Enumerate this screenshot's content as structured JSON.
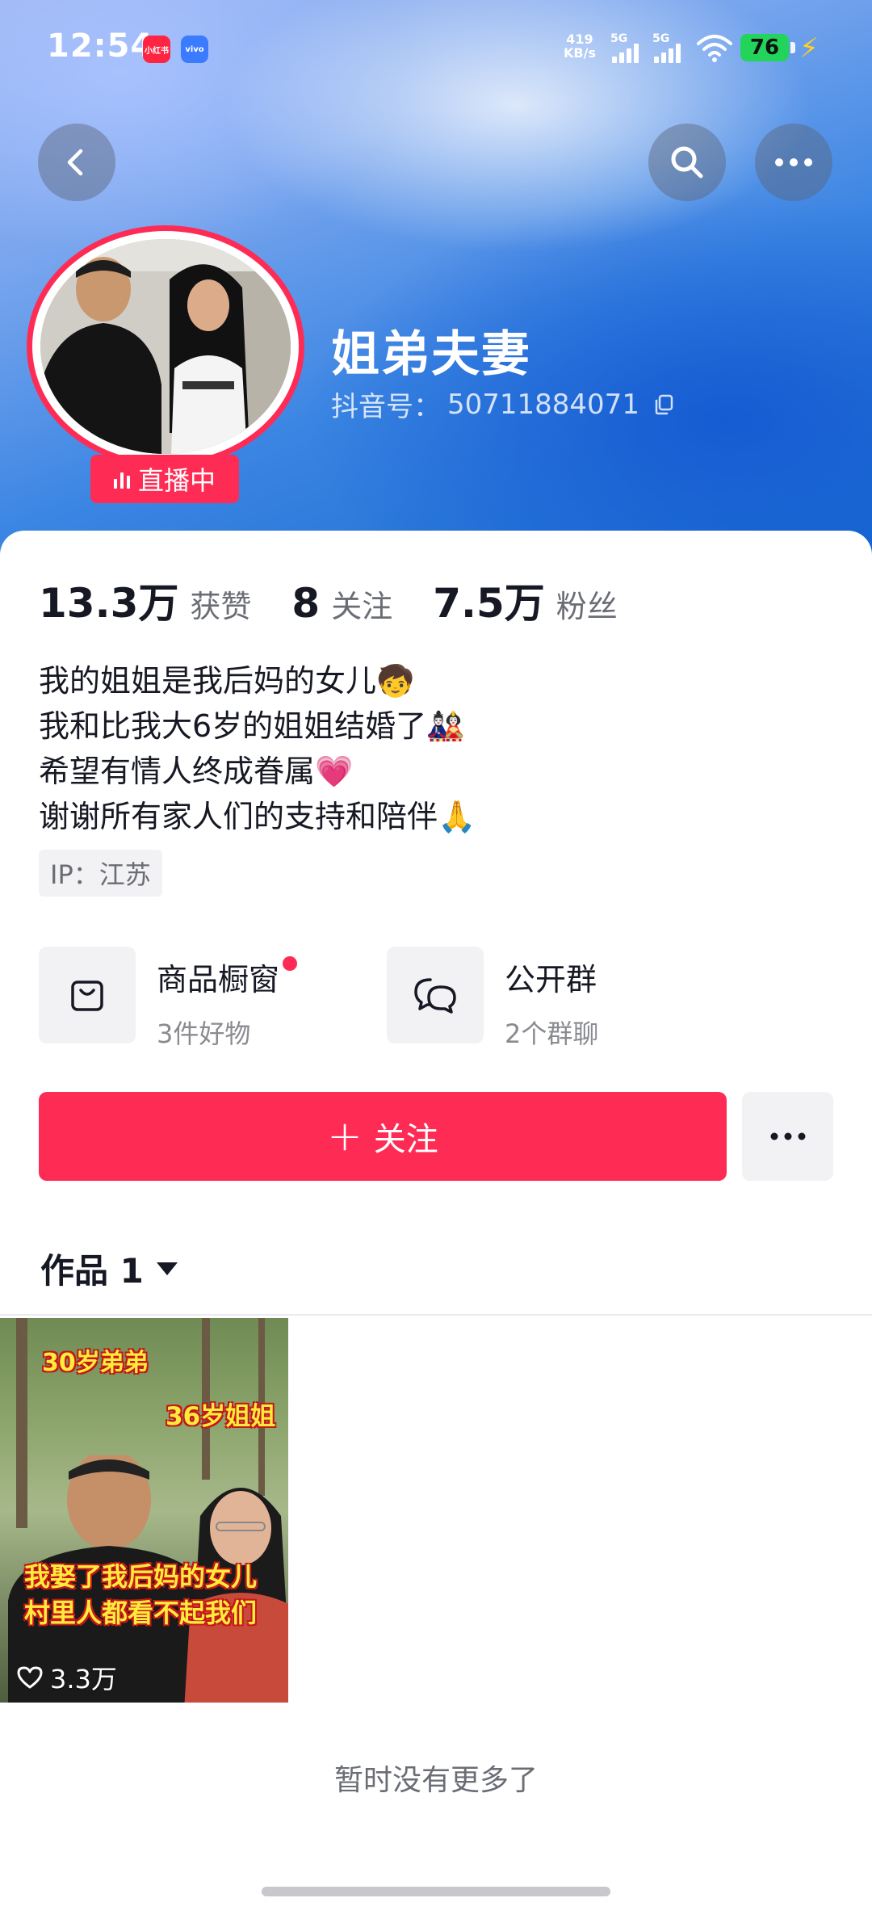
{
  "status_bar": {
    "time": "12:54",
    "app_icon_1": "小红书",
    "app_icon_2": "vivo",
    "net_speed_value": "419",
    "net_speed_unit": "KB/s",
    "signal_1_label": "5G",
    "signal_2_label": "5G",
    "battery": "76"
  },
  "profile": {
    "name": "姐弟夫妻",
    "douyin_id_label": "抖音号：",
    "douyin_id": "50711884071",
    "live_label": "直播中"
  },
  "stats": [
    {
      "value": "13.3万",
      "label": "获赞"
    },
    {
      "value": "8",
      "label": "关注"
    },
    {
      "value": "7.5万",
      "label": "粉丝"
    }
  ],
  "bio": [
    "我的姐姐是我后妈的女儿🧒",
    "我和比我大6岁的姐姐结婚了🎎",
    "希望有情人终成眷属💗",
    "谢谢所有家人们的支持和陪伴🙏"
  ],
  "ip": "IP：江苏",
  "features": {
    "shop": {
      "title": "商品橱窗",
      "subtitle": "3件好物"
    },
    "group": {
      "title": "公开群",
      "subtitle": "2个群聊"
    }
  },
  "actions": {
    "follow_label": "关注"
  },
  "works": {
    "tab_label": "作品 1"
  },
  "video": {
    "caption_top_left": "30岁弟弟",
    "caption_top_right": "36岁姐姐",
    "caption_line1": "我娶了我后妈的女儿",
    "caption_line2": "村里人都看不起我们",
    "likes": "3.3万"
  },
  "footer": {
    "no_more": "暂时没有更多了"
  },
  "colors": {
    "accent": "#fe2c55",
    "text": "#161823",
    "muted": "#6b6d75"
  }
}
